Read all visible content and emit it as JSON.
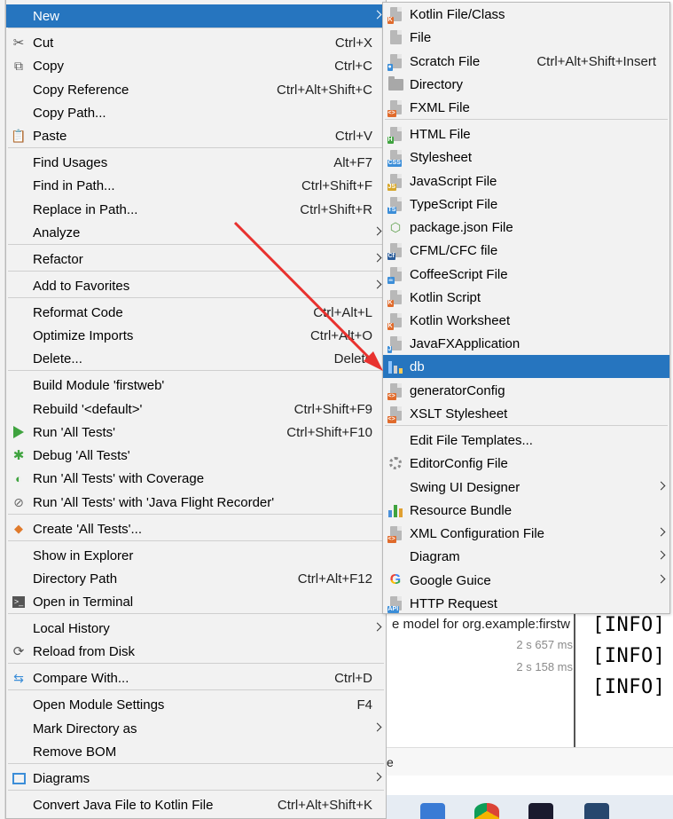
{
  "colors": {
    "accent": "#2675bf",
    "menu_bg": "#f2f2f2",
    "arrow": "#e8322f"
  },
  "context_menu": {
    "items": [
      {
        "label": "New",
        "shortcut": "",
        "icon": "none",
        "submenu": true,
        "selected": true
      },
      {
        "label": "Cut",
        "shortcut": "Ctrl+X",
        "icon": "scissors-icon"
      },
      {
        "label": "Copy",
        "shortcut": "Ctrl+C",
        "icon": "copy-icon"
      },
      {
        "label": "Copy Reference",
        "shortcut": "Ctrl+Alt+Shift+C",
        "icon": "none"
      },
      {
        "label": "Copy Path...",
        "shortcut": "",
        "icon": "none"
      },
      {
        "label": "Paste",
        "shortcut": "Ctrl+V",
        "icon": "paste-icon"
      },
      {
        "label": "Find Usages",
        "shortcut": "Alt+F7",
        "icon": "none"
      },
      {
        "label": "Find in Path...",
        "shortcut": "Ctrl+Shift+F",
        "icon": "none"
      },
      {
        "label": "Replace in Path...",
        "shortcut": "Ctrl+Shift+R",
        "icon": "none"
      },
      {
        "label": "Analyze",
        "shortcut": "",
        "icon": "none",
        "submenu": true
      },
      {
        "label": "Refactor",
        "shortcut": "",
        "icon": "none",
        "submenu": true
      },
      {
        "label": "Add to Favorites",
        "shortcut": "",
        "icon": "none",
        "submenu": true
      },
      {
        "label": "Reformat Code",
        "shortcut": "Ctrl+Alt+L",
        "icon": "none"
      },
      {
        "label": "Optimize Imports",
        "shortcut": "Ctrl+Alt+O",
        "icon": "none"
      },
      {
        "label": "Delete...",
        "shortcut": "Delete",
        "icon": "none"
      },
      {
        "label": "Build Module 'firstweb'",
        "shortcut": "",
        "icon": "none"
      },
      {
        "label": "Rebuild '<default>'",
        "shortcut": "Ctrl+Shift+F9",
        "icon": "none"
      },
      {
        "label": "Run 'All Tests'",
        "shortcut": "Ctrl+Shift+F10",
        "icon": "run-icon"
      },
      {
        "label": "Debug 'All Tests'",
        "shortcut": "",
        "icon": "debug-icon"
      },
      {
        "label": "Run 'All Tests' with Coverage",
        "shortcut": "",
        "icon": "coverage-icon"
      },
      {
        "label": "Run 'All Tests' with 'Java Flight Recorder'",
        "shortcut": "",
        "icon": "profiler-icon"
      },
      {
        "label": "Create 'All Tests'...",
        "shortcut": "",
        "icon": "create-test-icon"
      },
      {
        "label": "Show in Explorer",
        "shortcut": "",
        "icon": "none"
      },
      {
        "label": "Directory Path",
        "shortcut": "Ctrl+Alt+F12",
        "icon": "none"
      },
      {
        "label": "Open in Terminal",
        "shortcut": "",
        "icon": "terminal-icon"
      },
      {
        "label": "Local History",
        "shortcut": "",
        "icon": "none",
        "submenu": true
      },
      {
        "label": "Reload from Disk",
        "shortcut": "",
        "icon": "reload-icon"
      },
      {
        "label": "Compare With...",
        "shortcut": "Ctrl+D",
        "icon": "compare-icon"
      },
      {
        "label": "Open Module Settings",
        "shortcut": "F4",
        "icon": "none"
      },
      {
        "label": "Mark Directory as",
        "shortcut": "",
        "icon": "none",
        "submenu": true
      },
      {
        "label": "Remove BOM",
        "shortcut": "",
        "icon": "none"
      },
      {
        "label": "Diagrams",
        "shortcut": "",
        "icon": "diagram-icon",
        "submenu": true
      },
      {
        "label": "Convert Java File to Kotlin File",
        "shortcut": "Ctrl+Alt+Shift+K",
        "icon": "none"
      }
    ]
  },
  "new_submenu": {
    "items": [
      {
        "label": "Kotlin File/Class",
        "shortcut": "",
        "icon": "kotlin-file-icon"
      },
      {
        "label": "File",
        "shortcut": "",
        "icon": "file-icon"
      },
      {
        "label": "Scratch File",
        "shortcut": "Ctrl+Alt+Shift+Insert",
        "icon": "scratch-file-icon"
      },
      {
        "label": "Directory",
        "shortcut": "",
        "icon": "folder-icon"
      },
      {
        "label": "FXML File",
        "shortcut": "",
        "icon": "fxml-file-icon"
      },
      {
        "label": "HTML File",
        "shortcut": "",
        "icon": "html-file-icon"
      },
      {
        "label": "Stylesheet",
        "shortcut": "",
        "icon": "css-file-icon"
      },
      {
        "label": "JavaScript File",
        "shortcut": "",
        "icon": "js-file-icon"
      },
      {
        "label": "TypeScript File",
        "shortcut": "",
        "icon": "ts-file-icon"
      },
      {
        "label": "package.json File",
        "shortcut": "",
        "icon": "nodejs-icon"
      },
      {
        "label": "CFML/CFC file",
        "shortcut": "",
        "icon": "cfml-file-icon"
      },
      {
        "label": "CoffeeScript File",
        "shortcut": "",
        "icon": "coffeescript-file-icon"
      },
      {
        "label": "Kotlin Script",
        "shortcut": "",
        "icon": "kotlin-script-icon"
      },
      {
        "label": "Kotlin Worksheet",
        "shortcut": "",
        "icon": "kotlin-worksheet-icon"
      },
      {
        "label": "JavaFXApplication",
        "shortcut": "",
        "icon": "javafx-icon"
      },
      {
        "label": "db",
        "shortcut": "",
        "icon": "template-file-icon",
        "selected": true
      },
      {
        "label": "generatorConfig",
        "shortcut": "",
        "icon": "xml-file-icon"
      },
      {
        "label": "XSLT Stylesheet",
        "shortcut": "",
        "icon": "xslt-file-icon"
      },
      {
        "label": "Edit File Templates...",
        "shortcut": "",
        "icon": "none"
      },
      {
        "label": "EditorConfig File",
        "shortcut": "",
        "icon": "gear-icon"
      },
      {
        "label": "Swing UI Designer",
        "shortcut": "",
        "icon": "none",
        "submenu": true
      },
      {
        "label": "Resource Bundle",
        "shortcut": "",
        "icon": "resource-bundle-icon"
      },
      {
        "label": "XML Configuration File",
        "shortcut": "",
        "icon": "xml-config-icon",
        "submenu": true
      },
      {
        "label": "Diagram",
        "shortcut": "",
        "icon": "none",
        "submenu": true
      },
      {
        "label": "Google Guice",
        "shortcut": "",
        "icon": "google-icon",
        "submenu": true
      },
      {
        "label": "HTTP Request",
        "shortcut": "",
        "icon": "api-icon"
      }
    ]
  },
  "background": {
    "run_text": "e model for org.example:firstw",
    "times": [
      "2 s 657 ms",
      "2 s 158 ms"
    ],
    "log_lines": [
      "[INFO]",
      "[INFO]",
      "[INFO]"
    ],
    "status_fragment": "e"
  }
}
